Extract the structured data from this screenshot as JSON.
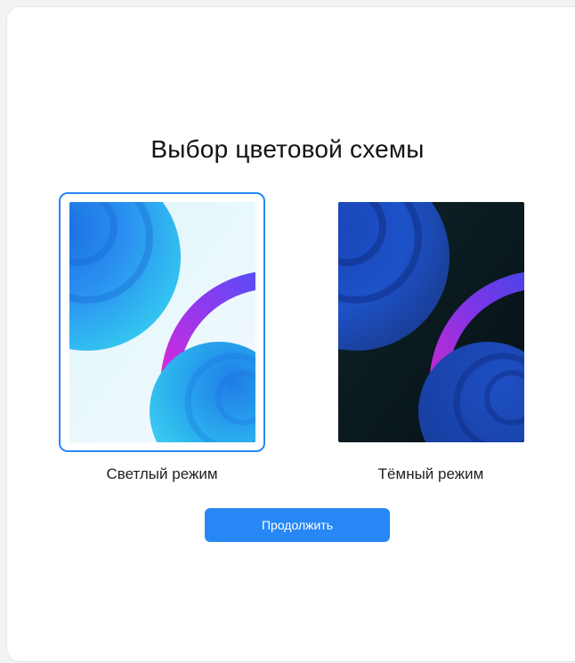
{
  "dialog": {
    "title": "Выбор цветовой схемы",
    "options": [
      {
        "id": "light",
        "label": "Светлый режим",
        "selected": true
      },
      {
        "id": "dark",
        "label": "Тёмный режим",
        "selected": false
      }
    ],
    "continue_label": "Продолжить"
  },
  "colors": {
    "accent": "#2787f5",
    "light_bg": "#e8f6fb",
    "dark_bg": "#0d1f25"
  }
}
